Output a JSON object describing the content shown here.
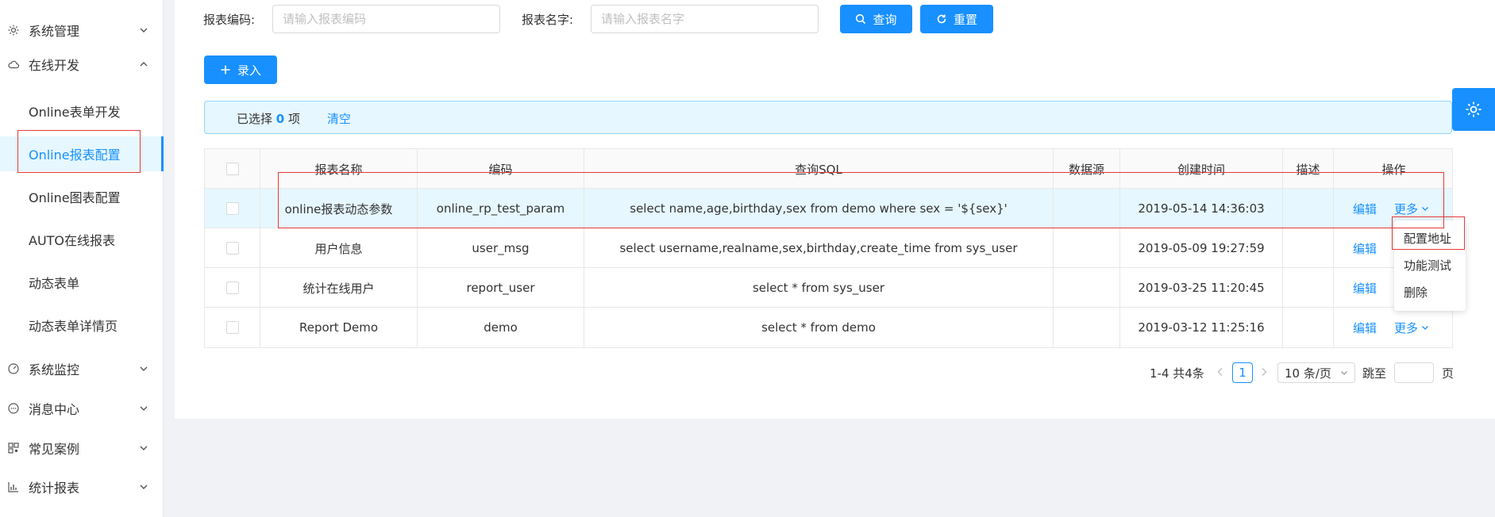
{
  "sidebar": {
    "menus": [
      {
        "label": "系统管理",
        "icon": "gear-icon",
        "expanded": false
      },
      {
        "label": "在线开发",
        "icon": "cloud-icon",
        "expanded": true
      },
      {
        "label": "系统监控",
        "icon": "dashboard-icon",
        "expanded": false
      },
      {
        "label": "消息中心",
        "icon": "message-icon",
        "expanded": false
      },
      {
        "label": "常见案例",
        "icon": "qrcode-icon",
        "expanded": false
      },
      {
        "label": "统计报表",
        "icon": "bar-chart-icon",
        "expanded": false
      }
    ],
    "sub_items": [
      {
        "label": "Online表单开发"
      },
      {
        "label": "Online报表配置",
        "active": true
      },
      {
        "label": "Online图表配置"
      },
      {
        "label": "AUTO在线报表"
      },
      {
        "label": "动态表单"
      },
      {
        "label": "动态表单详情页"
      }
    ]
  },
  "search": {
    "code_label": "报表编码:",
    "code_placeholder": "请输入报表编码",
    "name_label": "报表名字:",
    "name_placeholder": "请输入报表名字",
    "query_label": "查询",
    "reset_label": "重置"
  },
  "toolbar": {
    "add_label": "录入"
  },
  "alert": {
    "prefix": "已选择 ",
    "count": "0",
    "suffix": " 项",
    "clear_label": "清空"
  },
  "table": {
    "headers": [
      "报表名称",
      "编码",
      "查询SQL",
      "数据源",
      "创建时间",
      "描述",
      "操作"
    ],
    "rows": [
      {
        "name": "online报表动态参数",
        "code": "online_rp_test_param",
        "sql": "select name,age,birthday,sex from demo where sex = '${sex}'",
        "datasource": "",
        "created": "2019-05-14 14:36:03",
        "desc": ""
      },
      {
        "name": "用户信息",
        "code": "user_msg",
        "sql": "select username,realname,sex,birthday,create_time from sys_user",
        "datasource": "",
        "created": "2019-05-09 19:27:59",
        "desc": ""
      },
      {
        "name": "统计在线用户",
        "code": "report_user",
        "sql": "select * from sys_user",
        "datasource": "",
        "created": "2019-03-25 11:20:45",
        "desc": ""
      },
      {
        "name": "Report Demo",
        "code": "demo",
        "sql": "select * from demo",
        "datasource": "",
        "created": "2019-03-12 11:25:16",
        "desc": ""
      }
    ],
    "edit_label": "编辑",
    "more_label": "更多"
  },
  "dropdown": {
    "items": [
      "配置地址",
      "功能测试",
      "删除"
    ]
  },
  "pagination": {
    "total_text": "1-4 共4条",
    "current_page": "1",
    "page_size": "10 条/页",
    "jump_label": "跳至",
    "page_suffix": "页"
  },
  "colors": {
    "primary": "#1890ff",
    "annotation": "#e53935",
    "alert_bg": "#e6f7ff"
  }
}
